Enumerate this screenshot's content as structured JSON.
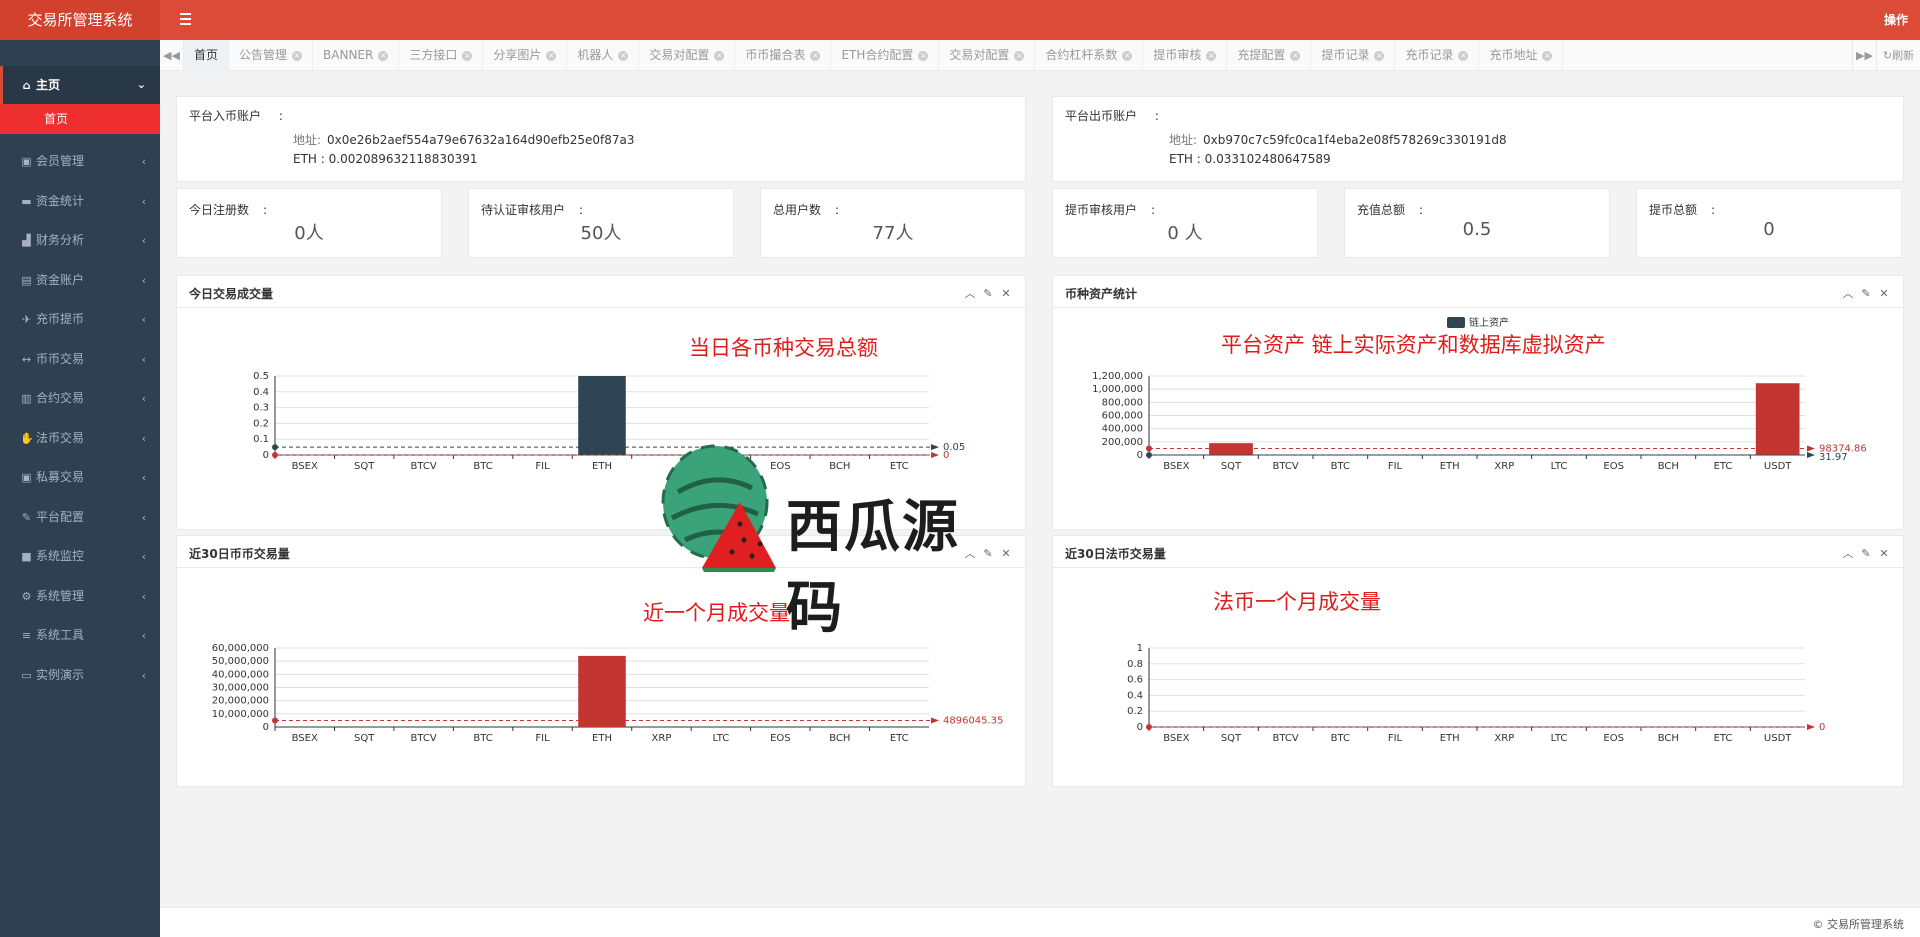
{
  "app": {
    "title": "交易所管理系统",
    "ops_label": "操作"
  },
  "sidebar": {
    "items": [
      {
        "icon": "⌂",
        "icon_name": "home-icon",
        "label": "主页",
        "active": true
      },
      {
        "icon": "▣",
        "icon_name": "member-icon",
        "label": "会员管理"
      },
      {
        "icon": "▬",
        "icon_name": "wallet-icon",
        "label": "资金统计"
      },
      {
        "icon": "▟",
        "icon_name": "area-chart-icon",
        "label": "财务分析"
      },
      {
        "icon": "▤",
        "icon_name": "account-icon",
        "label": "资金账户"
      },
      {
        "icon": "✈",
        "icon_name": "plane-icon",
        "label": "充币提币"
      },
      {
        "icon": "↔",
        "icon_name": "exchange-icon",
        "label": "币币交易"
      },
      {
        "icon": "▥",
        "icon_name": "book-icon",
        "label": "合约交易"
      },
      {
        "icon": "✋",
        "icon_name": "handshake-icon",
        "label": "法币交易"
      },
      {
        "icon": "▣",
        "icon_name": "user-card-icon",
        "label": "私募交易"
      },
      {
        "icon": "✎",
        "icon_name": "config-icon",
        "label": "平台配置"
      },
      {
        "icon": "■",
        "icon_name": "camera-icon",
        "label": "系统监控"
      },
      {
        "icon": "⚙",
        "icon_name": "gear-icon",
        "label": "系统管理"
      },
      {
        "icon": "≡",
        "icon_name": "list-icon",
        "label": "系统工具"
      },
      {
        "icon": "▭",
        "icon_name": "desktop-icon",
        "label": "实例演示"
      }
    ],
    "submenu": "首页"
  },
  "tabs": [
    "首页",
    "公告管理",
    "BANNER",
    "三方接口",
    "分享图片",
    "机器人",
    "交易对配置",
    "币币撮合表",
    "ETH合约配置",
    "交易对配置",
    "合约杠杆系数",
    "提币审核",
    "充提配置",
    "提币记录",
    "充币记录",
    "充币地址"
  ],
  "refresh_label": "刷新",
  "accounts": {
    "in": {
      "title": "平台入币账户",
      "addr_label": "地址:",
      "addr": "0x0e26b2aef554a79e67632a164d90efb25e0f87a3",
      "eth_label": "ETH :",
      "eth": "0.002089632118830391"
    },
    "out": {
      "title": "平台出币账户",
      "addr_label": "地址:",
      "addr": "0xb970c7c59fc0ca1f4eba2e08f578269c330191d8",
      "eth_label": "ETH :",
      "eth": "0.033102480647589"
    }
  },
  "stats": [
    {
      "title": "今日注册数",
      "value": "0人"
    },
    {
      "title": "待认证审核用户",
      "value": "50人"
    },
    {
      "title": "总用户数",
      "value": "77人"
    },
    {
      "title": "提币审核用户",
      "value": "0 人"
    },
    {
      "title": "充值总额",
      "value": "0.5"
    },
    {
      "title": "提币总额",
      "value": "0"
    }
  ],
  "colon": ":",
  "charts": {
    "today": {
      "title": "今日交易成交量",
      "annotation": "当日各币种交易总额"
    },
    "assets": {
      "title": "币种资产统计",
      "annotation": "平台资产 链上实际资产和数据库虚拟资产"
    },
    "coin30": {
      "title": "近30日币币交易量",
      "annotation": "近一个月成交量"
    },
    "fiat30": {
      "title": "近30日法币交易量",
      "annotation": "法币一个月成交量"
    }
  },
  "watermark": {
    "text": "西瓜源码"
  },
  "footer": "© 交易所管理系统",
  "colors": {
    "brand": "#dc4b38",
    "sidebar": "#2f4050",
    "bar_dark": "#2f4554",
    "bar_red": "#c23531",
    "annot": "#e21b1b"
  },
  "chart_data": [
    {
      "type": "bar",
      "categories": [
        "BSEX",
        "SQT",
        "BTCV",
        "BTC",
        "FIL",
        "ETH",
        "XRP",
        "LTC",
        "EOS",
        "BCH",
        "ETC"
      ],
      "visible_categories": [
        "BSEX",
        "SQT",
        "BTCV",
        "BTC",
        "FIL",
        "ETH",
        "EOS",
        "BCH",
        "ETC"
      ],
      "values": [
        0,
        0,
        0,
        0,
        0,
        0.5,
        0,
        0,
        0,
        0,
        0
      ],
      "ylim": [
        0,
        0.5
      ],
      "yticks": [
        "0",
        "0.1",
        "0.2",
        "0.3",
        "0.4",
        "0.5"
      ],
      "marklines": [
        {
          "value": 0.05,
          "label": "0.05",
          "color": "#2f4554"
        },
        {
          "value": 0,
          "label": "0",
          "color": "#c23531"
        }
      ],
      "bar_color": "#2f4554"
    },
    {
      "type": "bar",
      "categories": [
        "BSEX",
        "SQT",
        "BTCV",
        "BTC",
        "FIL",
        "ETH",
        "XRP",
        "LTC",
        "EOS",
        "BCH",
        "ETC",
        "USDT"
      ],
      "legend": [
        "链上资产"
      ],
      "values": [
        0,
        180000,
        0,
        0,
        0,
        0,
        0,
        0,
        0,
        0,
        0,
        1090000
      ],
      "ylim": [
        0,
        1200000
      ],
      "yticks": [
        "0",
        "200,000",
        "400,000",
        "600,000",
        "800,000",
        "1,000,000",
        "1,200,000"
      ],
      "marklines": [
        {
          "value": 98374.86,
          "label": "98374.86",
          "color": "#c23531"
        },
        {
          "value": 31.97,
          "label": "31.97",
          "color": "#2f4554"
        }
      ],
      "bar_color": "#c23531"
    },
    {
      "type": "bar",
      "categories": [
        "BSEX",
        "SQT",
        "BTCV",
        "BTC",
        "FIL",
        "ETH",
        "XRP",
        "LTC",
        "EOS",
        "BCH",
        "ETC"
      ],
      "values": [
        0,
        0,
        0,
        0,
        0,
        54000000,
        0,
        0,
        0,
        0,
        0
      ],
      "ylim": [
        0,
        60000000
      ],
      "yticks": [
        "0",
        "10,000,000",
        "20,000,000",
        "30,000,000",
        "40,000,000",
        "50,000,000",
        "60,000,000"
      ],
      "marklines": [
        {
          "value": 4896045.35,
          "label": "4896045.35",
          "color": "#c23531"
        }
      ],
      "bar_color": "#c23531"
    },
    {
      "type": "bar",
      "categories": [
        "BSEX",
        "SQT",
        "BTCV",
        "BTC",
        "FIL",
        "ETH",
        "XRP",
        "LTC",
        "EOS",
        "BCH",
        "ETC",
        "USDT"
      ],
      "values": [
        0,
        0,
        0,
        0,
        0,
        0,
        0,
        0,
        0,
        0,
        0,
        0
      ],
      "ylim": [
        0,
        1
      ],
      "yticks": [
        "0",
        "0.2",
        "0.4",
        "0.6",
        "0.8",
        "1"
      ],
      "marklines": [
        {
          "value": 0,
          "label": "0",
          "color": "#c23531"
        }
      ],
      "bar_color": "#c23531"
    }
  ]
}
